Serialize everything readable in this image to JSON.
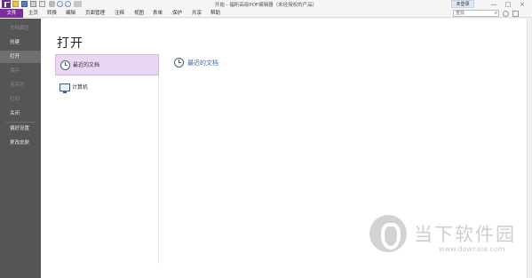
{
  "window": {
    "title": "开始 - 福昕高级PDF编辑器（未经授权的产品）",
    "controls": [
      "—",
      "□",
      "×"
    ]
  },
  "quick_access": [
    "logo-icon",
    "open-folder-icon",
    "save-icon",
    "print-icon",
    "email-icon",
    "undo-icon",
    "redo-icon",
    "hand-icon",
    "customize-icon"
  ],
  "menu": {
    "items": [
      "文件",
      "主页",
      "转换",
      "编辑",
      "页面管理",
      "注释",
      "视图",
      "表单",
      "保护",
      "共享",
      "帮助"
    ],
    "active": "文件"
  },
  "toolbar_right": {
    "login_label": "未登录",
    "search_placeholder": "查找"
  },
  "sidebar": {
    "items": [
      {
        "label": "文档属性",
        "state": "disabled"
      },
      {
        "label": "创建",
        "state": "normal"
      },
      {
        "label": "打开",
        "state": "active"
      },
      {
        "label": "保存",
        "state": "disabled"
      },
      {
        "label": "另存为",
        "state": "disabled"
      },
      {
        "label": "打印",
        "state": "disabled"
      },
      {
        "label": "关闭",
        "state": "normal"
      },
      {
        "label": "偏好设置",
        "state": "normal"
      },
      {
        "label": "更改皮肤",
        "state": "normal"
      }
    ]
  },
  "main": {
    "heading": "打开",
    "locations": [
      {
        "label": "最近的文档",
        "icon": "clock-icon",
        "selected": true
      },
      {
        "label": "计算机",
        "icon": "computer-icon",
        "selected": false
      }
    ],
    "detail_title": "最近的文档"
  },
  "watermark": {
    "text": "当下软件园",
    "url": "www.downxia.com"
  },
  "colors": {
    "accent": "#7a2e9e",
    "sidebar_bg": "#555555",
    "selected_bg": "#ead6f3",
    "link": "#3b6aa8"
  }
}
